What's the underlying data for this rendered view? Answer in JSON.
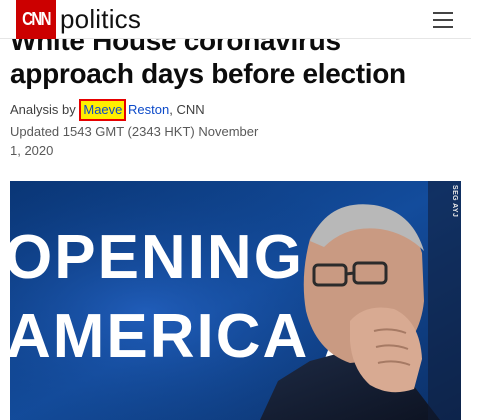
{
  "header": {
    "logo_text": "CNN",
    "section_name": "politics"
  },
  "article": {
    "headline": "White House coronavirus approach days before election",
    "byline": {
      "prefix": "Analysis by ",
      "author_first": "Maeve",
      "author_last": "Reston",
      "separator": ", ",
      "outlet": "CNN"
    },
    "timestamp": "Updated 1543 GMT (2343 HKT) November 1, 2020"
  },
  "hero_image": {
    "sign_line_1": "OPENING",
    "sign_line_2": "AMERICA A",
    "credit": "SEG AYJ"
  },
  "colors": {
    "brand_red": "#cc0000",
    "highlight_yellow": "#ffef00",
    "link_blue": "#0c4ac9"
  },
  "icons": {
    "menu": "hamburger-menu-icon"
  }
}
